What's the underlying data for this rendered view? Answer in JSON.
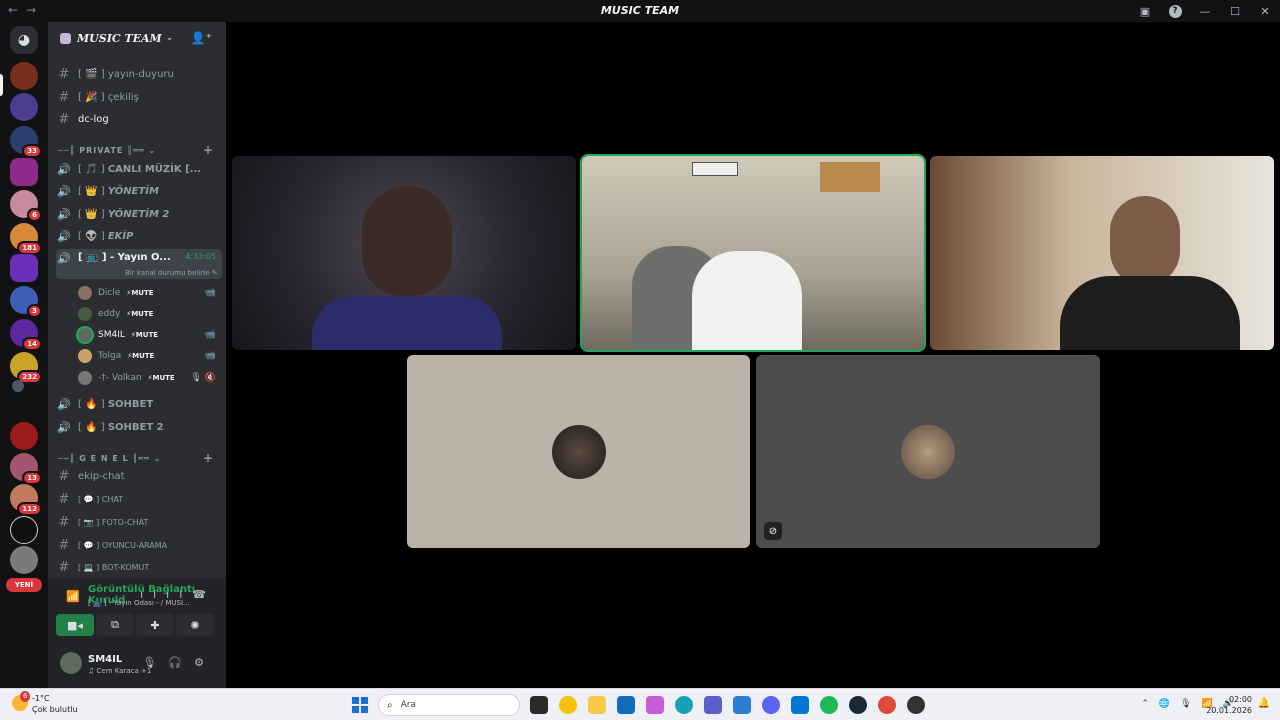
{
  "titlebar": {
    "title": "MUSIC TEAM",
    "back": "←",
    "forward": "→",
    "help": "?",
    "minimize": "—",
    "maximize": "☐",
    "close": "✕"
  },
  "servers": {
    "new_label": "YENİ",
    "badges": [
      "33",
      "6",
      "181",
      "3",
      "14",
      "232",
      "13",
      "112"
    ]
  },
  "guild": {
    "name": "MUSIC TEAM"
  },
  "channels_top": [
    {
      "name": "yayın-duyuru",
      "prefix": "[ 🎬 ]"
    },
    {
      "name": "çekiliş",
      "prefix": "[ 🎉 ]"
    },
    {
      "name": "dc-log",
      "prefix": ""
    }
  ],
  "categories": {
    "private": "PRIVATE",
    "genel": "G E N E L"
  },
  "voice_channels": [
    {
      "name": "CANLI MÜZİK [...",
      "prefix": "[ 🎵 ]"
    },
    {
      "name": "YÖNETİM",
      "prefix": "[ 👑 ]"
    },
    {
      "name": "YÖNETİM 2",
      "prefix": "[ 👑 ]"
    },
    {
      "name": "EKİP",
      "prefix": "[ 👽 ]"
    },
    {
      "name": "- Yayın O...",
      "prefix": "[ 📺 ]",
      "timer": "4:33:05",
      "status": "Bir kanal durumu belirle"
    }
  ],
  "voice_users": [
    {
      "name": "Dicle",
      "mute": "⚡MUTE",
      "cam": "📹"
    },
    {
      "name": "eddy",
      "mute": "⚡MUTE",
      "cam": ""
    },
    {
      "name": "SM4IL",
      "mute": "⚡MUTE",
      "cam": "📹"
    },
    {
      "name": "Tolga",
      "mute": "⚡MUTE",
      "cam": "📹"
    },
    {
      "name": "-†- Volkan",
      "mute": "⚡MUTE",
      "cam": "🎙 🔇"
    }
  ],
  "voice_channels_2": [
    {
      "name": "SOHBET",
      "prefix": "[ 🔥 ]"
    },
    {
      "name": "SOHBET 2",
      "prefix": "[ 🔥 ]"
    }
  ],
  "text_channels_genel": [
    {
      "name": "ekip-chat",
      "prefix": ""
    },
    {
      "name": "CHAT",
      "prefix": "[ 💬 ]"
    },
    {
      "name": "FOTO-CHAT",
      "prefix": "[ 📷 ]"
    },
    {
      "name": "OYUNCU-ARAMA",
      "prefix": "[ 💬 ]"
    },
    {
      "name": "BOT-KOMUT",
      "prefix": "[ 💻 ]"
    }
  ],
  "connection": {
    "status": "Görüntülü Bağlantı Kuruld",
    "sub": "[ 📺 ] - Yayın Odası - / MUSI..."
  },
  "user": {
    "name": "SM4IL",
    "sub": "♫ Cem Karaca +1"
  },
  "taskbar": {
    "weather_temp": "-1°C",
    "weather_desc": "Çok bulutlu",
    "weather_badge": "6",
    "search_placeholder": "Ara",
    "time": "02:00",
    "date": "20.01.2026"
  },
  "colors": {
    "accent_green": "#23a55a",
    "sidebar": "#2b2d31",
    "servers": "#121214"
  }
}
